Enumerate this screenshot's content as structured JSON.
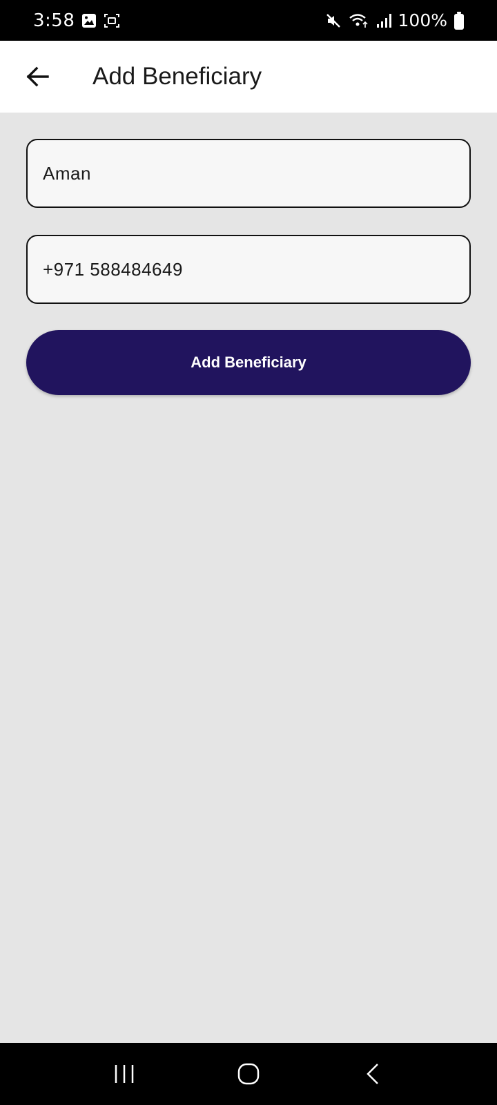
{
  "status_bar": {
    "time": "3:58",
    "battery": "100%",
    "icons": [
      "gallery-icon",
      "screenshot-icon",
      "mute-icon",
      "wifi-icon",
      "signal-icon",
      "battery-icon"
    ]
  },
  "app_bar": {
    "title": "Add Beneficiary",
    "back_icon": "arrow-left-icon"
  },
  "form": {
    "name_value": "Aman",
    "phone_value": "+971 588484649",
    "submit_label": "Add Beneficiary"
  },
  "colors": {
    "primary": "#21145e",
    "background": "#e5e5e5",
    "field_background": "#f7f7f7"
  },
  "nav_bar": {
    "icons": [
      "recents-icon",
      "home-icon",
      "back-icon"
    ]
  }
}
